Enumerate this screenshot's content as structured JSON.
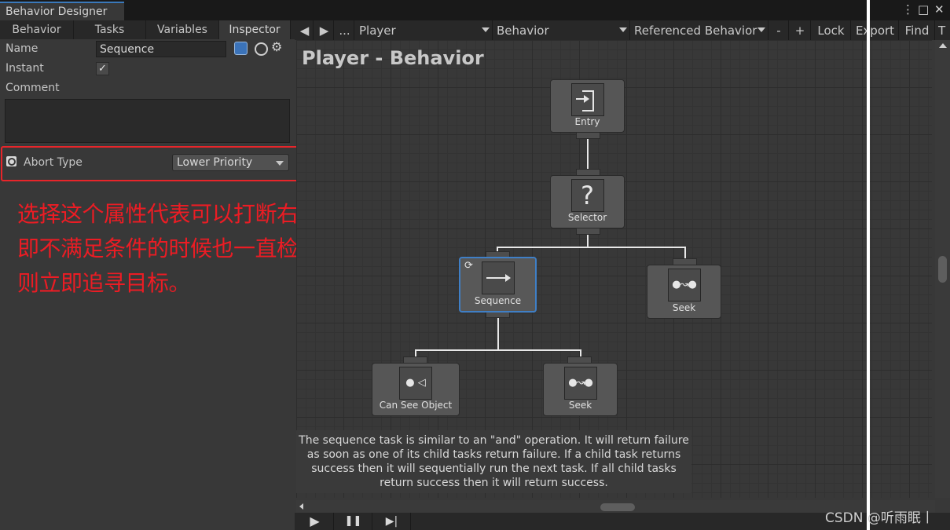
{
  "window": {
    "title": "Behavior Designer",
    "menu_icon": "⋮",
    "max_icon": "□",
    "close_icon": "✕"
  },
  "left_tabs": [
    "Behavior",
    "Tasks",
    "Variables",
    "Inspector"
  ],
  "inspector": {
    "name_label": "Name",
    "name_value": "Sequence",
    "instant_label": "Instant",
    "instant_checked": true,
    "check_glyph": "✓",
    "comment_label": "Comment",
    "abort_type_label": "Abort Type",
    "abort_type_value": "Lower Priority"
  },
  "annotation": {
    "line1": "选择这个属性代表可以打断右边Seek的操作，",
    "line2": "即不满足条件的时候也一直检测，如果满足条件",
    "line3": "则立即追寻目标。",
    "color": "#ec1c24"
  },
  "toolbar": {
    "prev": "◀",
    "next": "▶",
    "more": "...",
    "object_dd": "Player",
    "behavior_dd": "Behavior",
    "referenced_dd": "Referenced Behavior",
    "minus": "-",
    "plus": "+",
    "lock": "Lock",
    "export": "Export",
    "find": "Find",
    "extra": "T"
  },
  "graph": {
    "title": "Player - Behavior",
    "nodes": {
      "entry": "Entry",
      "selector": "Selector",
      "sequence": "Sequence",
      "seek_right": "Seek",
      "can_see": "Can See Object",
      "seek_bottom": "Seek"
    },
    "description": "The sequence task is similar to an \"and\" operation. It will return failure as soon as one of its child tasks return failure. If a child task returns success then it will sequentially run the next task. If all child tasks return success then it will return success."
  },
  "playback": {
    "play": "▶",
    "pause": "❚❚",
    "step": "▶|"
  },
  "watermark": "CSDN @听雨眠丨",
  "colors": {
    "selection": "#3f7fc6",
    "annotation_box": "#e8252a"
  }
}
